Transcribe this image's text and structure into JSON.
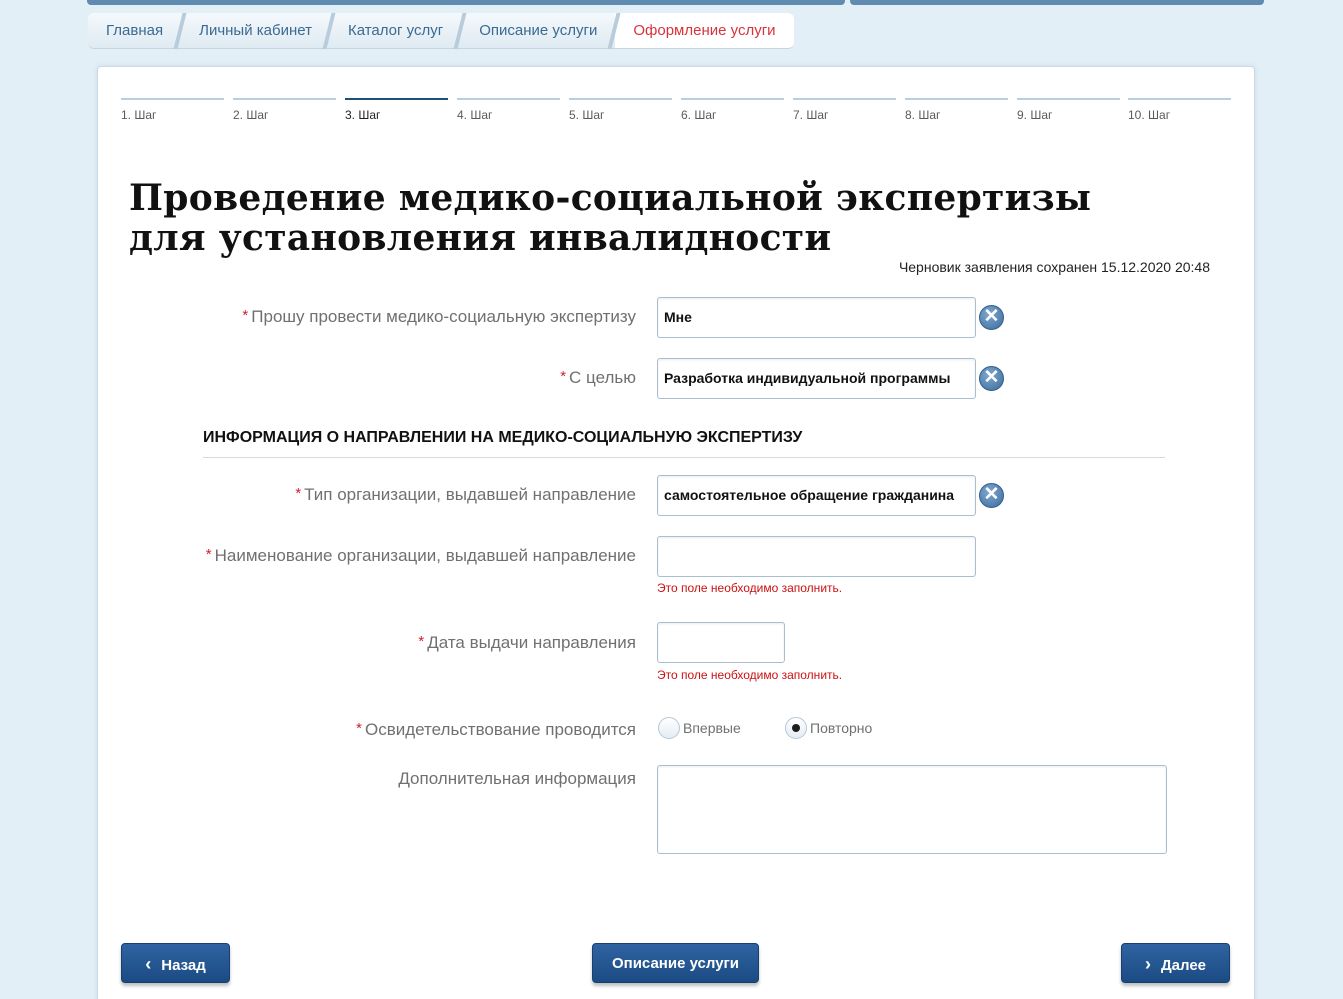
{
  "breadcrumb": [
    "Главная",
    "Личный кабинет",
    "Каталог услуг",
    "Описание услуги",
    "Оформление услуги"
  ],
  "steps": [
    "1. Шаг",
    "2. Шаг",
    "3. Шаг",
    "4. Шаг",
    "5. Шаг",
    "6. Шаг",
    "7. Шаг",
    "8. Шаг",
    "9. Шаг",
    "10. Шаг"
  ],
  "current_step": 3,
  "title": "Проведение медико-социальной экспертизы для установления инвалидности",
  "draft_status": "Черновик заявления сохранен 15.12.2020 20:48",
  "required_mark": "*",
  "fields": {
    "request_for": {
      "label": "Прошу провести медико-социальную экспертизу",
      "value": "Мне"
    },
    "purpose": {
      "label": "С целью",
      "value": "Разработка индивидуальной программы"
    },
    "org_type": {
      "label": "Тип организации, выдавшей направление",
      "value": "самостоятельное обращение гражданина"
    },
    "org_name": {
      "label": "Наименование организации, выдавшей направление",
      "value": "",
      "error": "Это поле необходимо заполнить."
    },
    "referral_date": {
      "label": "Дата выдачи направления",
      "value": "",
      "error": "Это поле необходимо заполнить."
    },
    "examination": {
      "label": "Освидетельствование проводится",
      "options": [
        "Впервые",
        "Повторно"
      ],
      "selected": "Повторно"
    },
    "additional_info": {
      "label": "Дополнительная информация",
      "value": ""
    }
  },
  "section_title": "ИНФОРМАЦИЯ О НАПРАВЛЕНИИ НА МЕДИКО-СОЦИАЛЬНУЮ ЭКСПЕРТИЗУ",
  "clear_glyph": "✕",
  "buttons": {
    "back": "Назад",
    "description": "Описание услуги",
    "next": "Далее",
    "back_arrow": "‹",
    "next_arrow": "›"
  },
  "colors": {
    "accent": "#1e4f7c",
    "active_crumb": "#d8333a",
    "error": "#cc1111"
  }
}
